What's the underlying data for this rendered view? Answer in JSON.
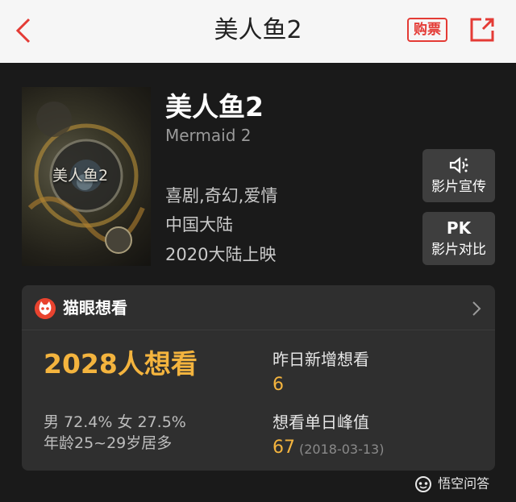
{
  "header": {
    "title": "美人鱼2",
    "back_icon": "back-arrow-icon",
    "buy_label": "购票",
    "share_icon": "share-icon"
  },
  "movie": {
    "poster_title": "美人鱼2",
    "name_cn": "美人鱼2",
    "name_en": "Mermaid 2",
    "genres": "喜剧,奇幻,爱情",
    "region": "中国大陆",
    "release": "2020大陆上映"
  },
  "side_actions": {
    "promo": {
      "icon": "speaker-icon",
      "label": "影片宣传"
    },
    "pk": {
      "icon_text": "PK",
      "label": "影片对比"
    }
  },
  "want_card": {
    "brand_icon": "cat-eye-logo-icon",
    "title": "猫眼想看",
    "count": "2028人想看",
    "gender": "男 72.4% 女 27.5%",
    "age": "年龄25~29岁居多",
    "yesterday_label": "昨日新增想看",
    "yesterday_value": "6",
    "peak_label": "想看单日峰值",
    "peak_value": "67",
    "peak_date": "(2018-03-13)"
  },
  "watermark": {
    "text": "悟空问答"
  },
  "colors": {
    "accent_red": "#e43b35",
    "accent_gold": "#f4b43e",
    "background_dark": "#1a1a1a",
    "card": "#2f2f2f"
  }
}
